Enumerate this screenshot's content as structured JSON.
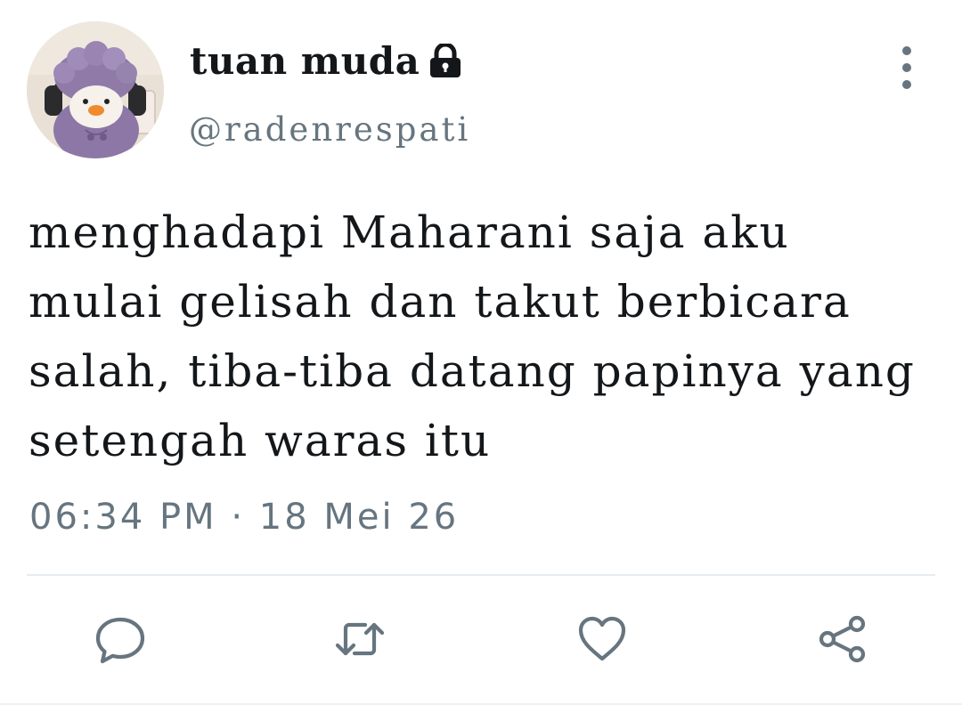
{
  "user": {
    "display_name": "tuan muda",
    "handle": "@radenrespati",
    "protected_icon": "lock-icon",
    "avatar": "avatar-photo"
  },
  "tweet": {
    "text": "menghadapi Maharani saja aku\nmulai gelisah dan takut berbicara\nsalah, tiba-tiba datang papinya yang\nsetengah waras itu",
    "timestamp": "06:34 PM · 18 Mei 26"
  },
  "menu": {
    "icon": "more-vertical-icon"
  },
  "actions": [
    {
      "name": "reply",
      "icon": "reply-icon"
    },
    {
      "name": "retweet",
      "icon": "retweet-icon"
    },
    {
      "name": "like",
      "icon": "heart-icon"
    },
    {
      "name": "share",
      "icon": "share-icon"
    }
  ],
  "colors": {
    "text": "#14171a",
    "secondary": "#66757f",
    "divider": "#e6ecf0"
  }
}
